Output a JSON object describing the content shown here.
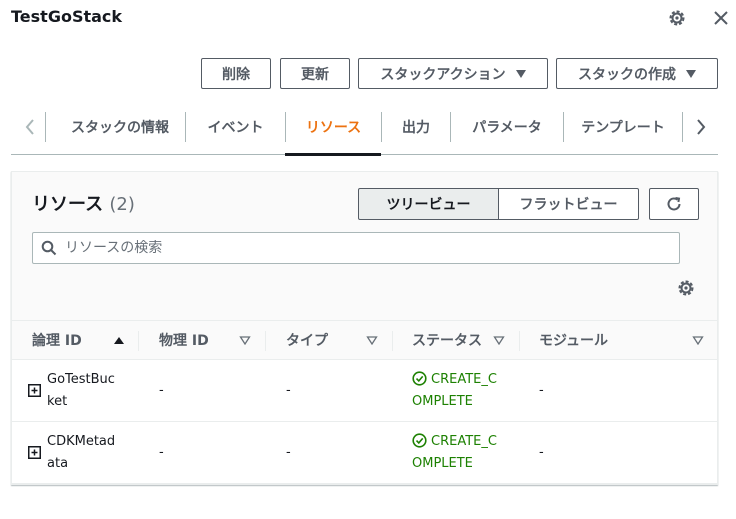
{
  "header": {
    "title": "TestGoStack"
  },
  "actions": {
    "delete": "削除",
    "update": "更新",
    "stack_actions": "スタックアクション",
    "create_stack": "スタックの作成"
  },
  "tabs": [
    {
      "label": "スタックの情報"
    },
    {
      "label": "イベント"
    },
    {
      "label": "リソース"
    },
    {
      "label": "出力"
    },
    {
      "label": "パラメータ"
    },
    {
      "label": "テンプレート"
    }
  ],
  "resources": {
    "title": "リソース",
    "count": "(2)",
    "tree_view": "ツリービュー",
    "flat_view": "フラットビュー",
    "search_placeholder": "リソースの検索",
    "columns": [
      "論理 ID",
      "物理 ID",
      "タイプ",
      "ステータス",
      "モジュール"
    ],
    "rows": [
      {
        "logical_id_l1": "GoTestBuc",
        "logical_id_l2": "ket",
        "physical_id": "-",
        "type": "-",
        "status_l1": "CREATE_C",
        "status_l2": "OMPLETE",
        "module": "-"
      },
      {
        "logical_id_l1": "CDKMetad",
        "logical_id_l2": "ata",
        "physical_id": "-",
        "type": "-",
        "status_l1": "CREATE_C",
        "status_l2": "OMPLETE",
        "module": "-"
      }
    ]
  },
  "colors": {
    "accent": "#ec7211",
    "success": "#1d8102",
    "text": "#16191f",
    "secondary": "#545b64"
  }
}
